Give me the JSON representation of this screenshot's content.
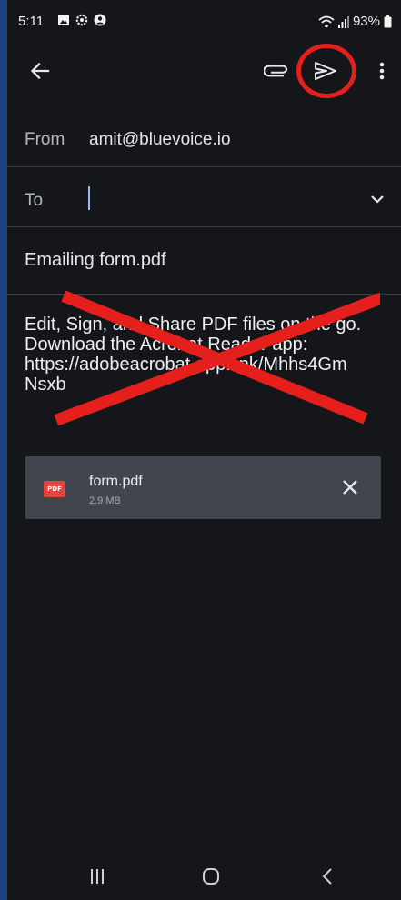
{
  "status_bar": {
    "time": "5:11",
    "battery": "93%",
    "icons": [
      "image-icon",
      "settings-icon",
      "account-icon",
      "wifi-icon",
      "signal-icon",
      "battery-icon"
    ]
  },
  "toolbar": {
    "icons": [
      "back-arrow-icon",
      "attach-icon",
      "send-icon",
      "more-vert-icon"
    ]
  },
  "compose": {
    "from_label": "From",
    "from_value": "amit@bluevoice.io",
    "to_label": "To",
    "to_value": "",
    "subject": "Emailing form.pdf",
    "body_lines": [
      "Edit, Sign, and Share PDF files on the go.",
      "Download the Acrobat Reader app:",
      "https://adobeacrobat.app.link/Mhhs4Gm",
      "Nsxb"
    ]
  },
  "attachment": {
    "icon_label": "PDF",
    "name": "form.pdf",
    "size": "2.9 MB"
  },
  "annotations": {
    "highlight_color": "#e5201c"
  },
  "colors": {
    "background": "#14161a",
    "attachment_bg": "#41454e",
    "caret": "#9fbaf3",
    "outer_border": "#1b4480"
  }
}
